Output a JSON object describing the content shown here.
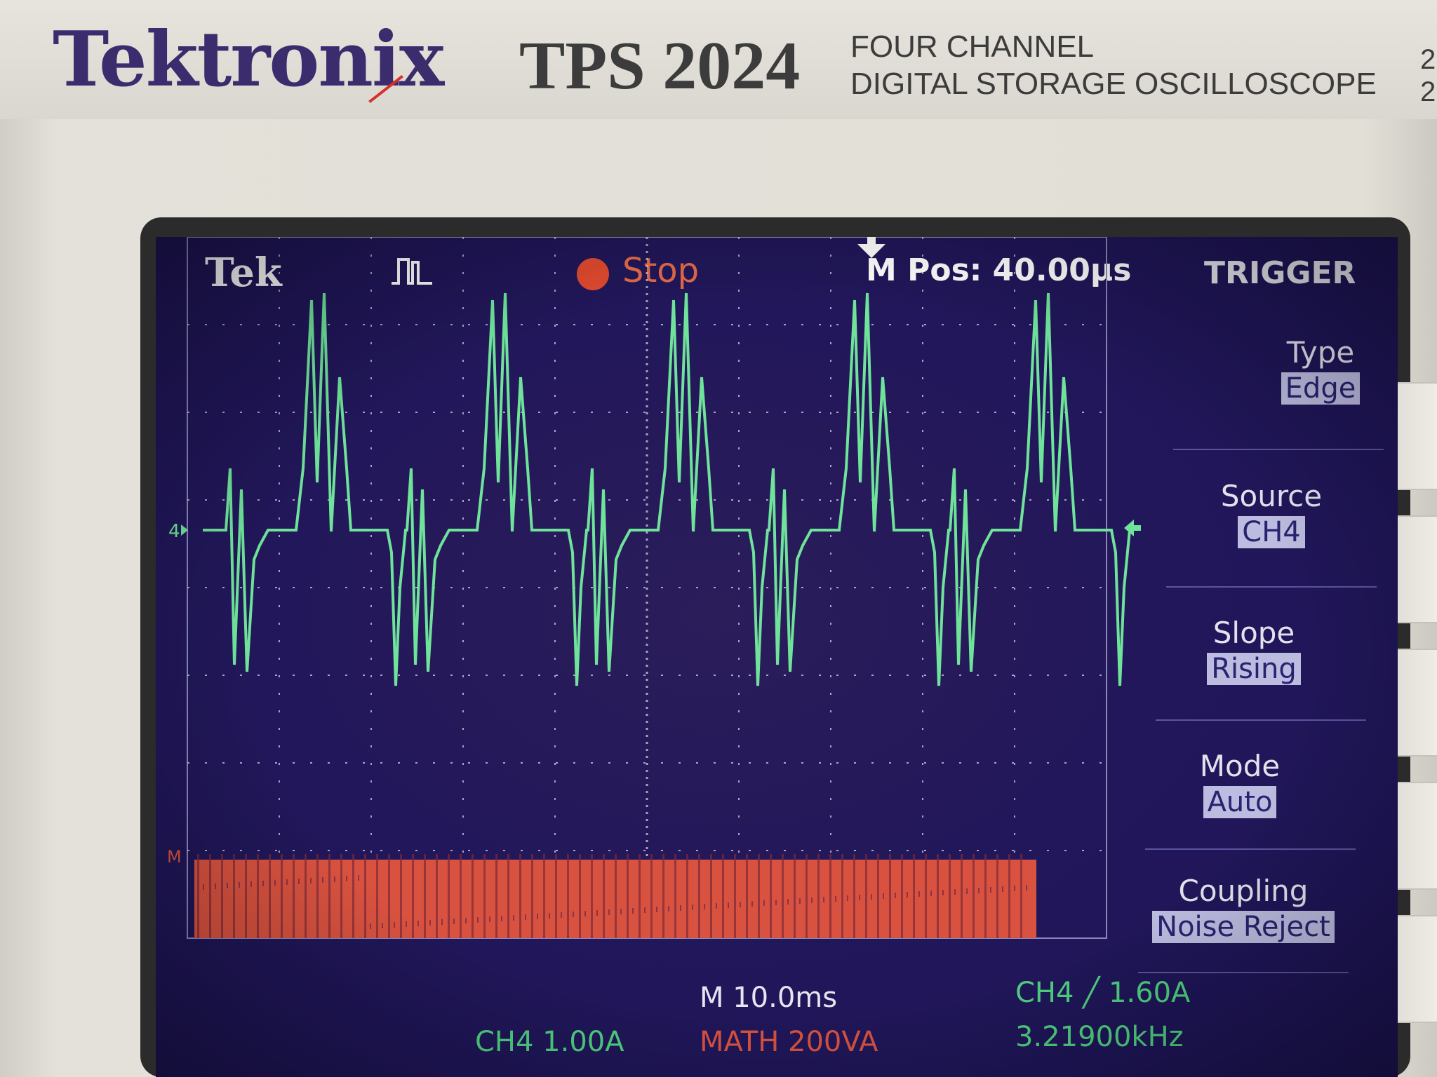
{
  "instrument": {
    "brand": "Tektronix",
    "model": "TPS 2024",
    "description_line1": "FOUR CHANNEL",
    "description_line2": "DIGITAL STORAGE OSCILLOSCOPE",
    "edge_digits": "2\n2"
  },
  "screen": {
    "logo": "Tek",
    "acquisition_icon": "pulse-icon",
    "run_status": "Stop",
    "run_status_color": "#e24a30",
    "m_pos": "M Pos: 40.00µs",
    "menu_title": "TRIGGER",
    "menu": [
      {
        "label": "Type",
        "value": "Edge"
      },
      {
        "label": "Source",
        "value": "CH4"
      },
      {
        "label": "Slope",
        "value": "Rising"
      },
      {
        "label": "Mode",
        "value": "Auto"
      },
      {
        "label": "Coupling",
        "value": "Noise Reject"
      }
    ],
    "channel_marker_ch4": "4",
    "channel_marker_math": "M",
    "readouts": {
      "timebase": "M 10.0ms",
      "ch4_scale": "CH4  1.00A",
      "math_scale": "MATH 200VA",
      "trigger": "CH4 ╱ 1.60A",
      "frequency": "3.21900kHz"
    },
    "colors": {
      "ch4_trace": "#6fe39a",
      "math_trace": "#d9523f",
      "background": "#22175a",
      "grid": "#c8c8dc"
    }
  }
}
